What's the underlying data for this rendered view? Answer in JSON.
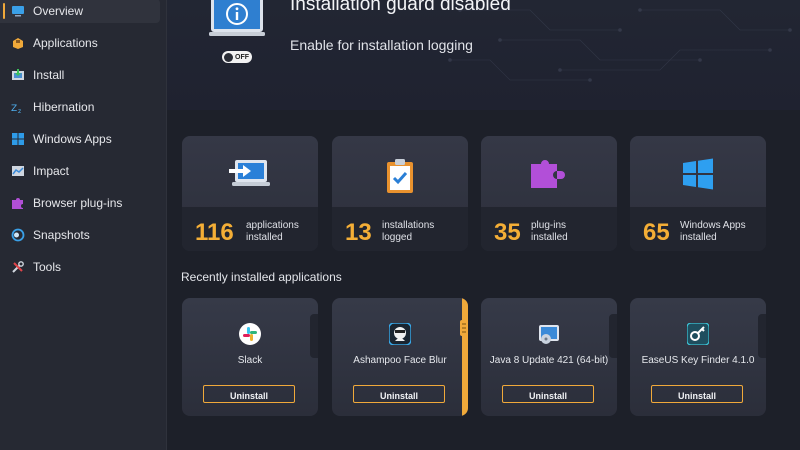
{
  "sidebar": {
    "items": [
      {
        "label": "Overview",
        "icon": "monitor-icon",
        "active": true
      },
      {
        "label": "Applications",
        "icon": "box-icon"
      },
      {
        "label": "Install",
        "icon": "install-icon"
      },
      {
        "label": "Hibernation",
        "icon": "sleep-icon"
      },
      {
        "label": "Windows Apps",
        "icon": "windows-icon"
      },
      {
        "label": "Impact",
        "icon": "chart-icon"
      },
      {
        "label": "Browser plug-ins",
        "icon": "puzzle-icon"
      },
      {
        "label": "Snapshots",
        "icon": "snapshot-icon"
      },
      {
        "label": "Tools",
        "icon": "tools-icon"
      }
    ]
  },
  "header": {
    "title": "Installation guard disabled",
    "subtitle": "Enable for installation logging",
    "toggle_label": "OFF"
  },
  "stats": [
    {
      "value": "116",
      "line1": "applications",
      "line2": "installed",
      "icon": "laptop-arrow-icon"
    },
    {
      "value": "13",
      "line1": "installations",
      "line2": "logged",
      "icon": "clipboard-check-icon"
    },
    {
      "value": "35",
      "line1": "plug-ins",
      "line2": "installed",
      "icon": "puzzle-icon"
    },
    {
      "value": "65",
      "line1": "Windows Apps",
      "line2": "installed",
      "icon": "windows-logo-icon"
    }
  ],
  "recent": {
    "title": "Recently installed applications",
    "apps": [
      {
        "name": "Slack",
        "icon": "slack-icon",
        "button": "Uninstall"
      },
      {
        "name": "Ashampoo Face Blur",
        "icon": "face-blur-icon",
        "button": "Uninstall"
      },
      {
        "name": "Java 8 Update 421 (64-bit)",
        "icon": "java-installer-icon",
        "button": "Uninstall"
      },
      {
        "name": "EaseUS Key Finder 4.1.0",
        "icon": "key-finder-icon",
        "button": "Uninstall"
      }
    ]
  },
  "colors": {
    "accent": "#f0a93a",
    "background": "#1d2029",
    "sidebar": "#262933"
  }
}
